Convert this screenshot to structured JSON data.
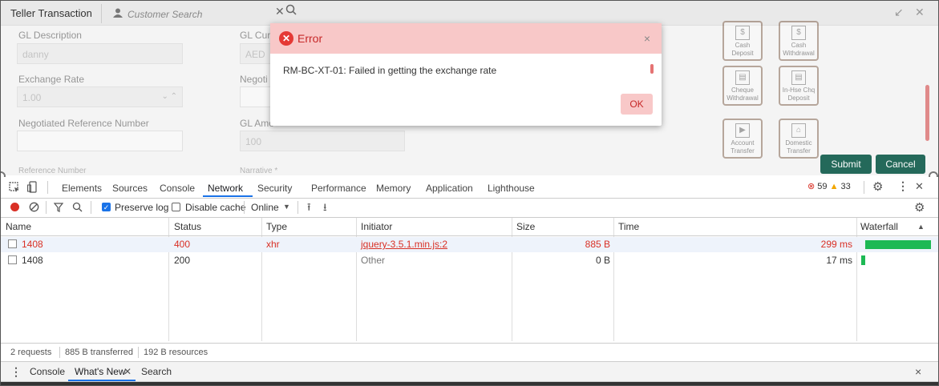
{
  "app": {
    "title": "Teller Transaction",
    "search_placeholder": "Customer Search",
    "search_clear": "✕",
    "fields": {
      "gl_description_label": "GL Description",
      "gl_description_value": "danny",
      "gl_currency_label": "GL Curr",
      "gl_currency_value": "AED",
      "exchange_rate_label": "Exchange Rate",
      "exchange_rate_value": "1.00",
      "negotiated_label": "Negoti",
      "negotiated_ref_label": "Negotiated Reference Number",
      "gl_amount_label": "GL Amo",
      "gl_amount_value": "100",
      "reference_number_label": "Reference Number",
      "narrative_label": "Narrative *"
    },
    "quick_actions": [
      "Cash Deposit",
      "Cash Withdrawal",
      "Cheque Withdrawal",
      "In-Hse Chq Deposit",
      "Account Transfer",
      "Domestic Transfer"
    ],
    "submit_label": "Submit",
    "cancel_label": "Cancel"
  },
  "dialog": {
    "title": "Error",
    "close": "×",
    "message": "RM-BC-XT-01: Failed in getting the exchange rate",
    "ok_label": "OK"
  },
  "devtools": {
    "tabs": [
      "Elements",
      "Sources",
      "Console",
      "Network",
      "Security",
      "Performance",
      "Memory",
      "Application",
      "Lighthouse"
    ],
    "active_tab": "Network",
    "errors_count": "59",
    "warnings_count": "33",
    "toolbar": {
      "preserve_log": "Preserve log",
      "disable_cache": "Disable cache",
      "throttle": "Online"
    },
    "columns": [
      "Name",
      "Status",
      "Type",
      "Initiator",
      "Size",
      "Time",
      "Waterfall"
    ],
    "rows": [
      {
        "name": "1408",
        "status": "400",
        "type": "xhr",
        "initiator": "jquery-3.5.1.min.js:2",
        "size": "885 B",
        "time": "299 ms",
        "waterfall": 1.0
      },
      {
        "name": "1408",
        "status": "200",
        "type": "",
        "initiator": "Other",
        "size": "0 B",
        "time": "17 ms",
        "waterfall": 0.06
      }
    ],
    "summary": {
      "requests": "2 requests",
      "transferred": "885 B transferred",
      "resources": "192 B resources"
    },
    "drawer": {
      "tabs": [
        "Console",
        "What's New",
        "Search"
      ],
      "active": "What's New",
      "close": "×"
    }
  },
  "colors": {
    "error_red": "#d93025",
    "accent_blue": "#1a73e8",
    "waterfall_green": "#1db954",
    "dialog_header": "#f8c8c8",
    "button_teal": "#0e5a4a"
  }
}
